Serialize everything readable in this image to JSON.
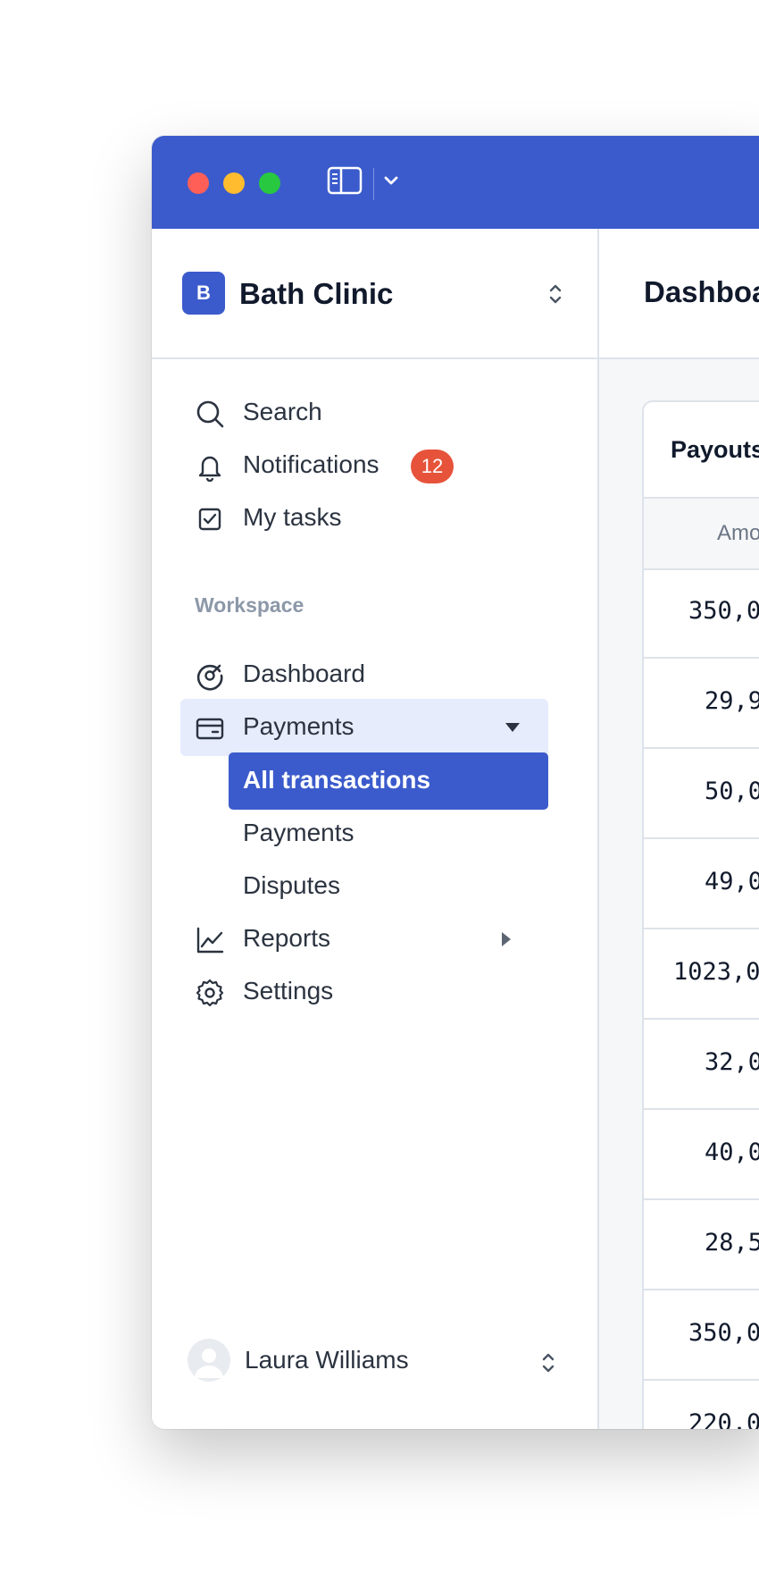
{
  "org": {
    "initial": "B",
    "name": "Bath Clinic"
  },
  "nav": {
    "search": "Search",
    "notifications": "Notifications",
    "notifications_count": "12",
    "tasks": "My tasks",
    "section": "Workspace",
    "dashboard": "Dashboard",
    "payments": "Payments",
    "payments_sub": [
      "All transactions",
      "Payments",
      "Disputes"
    ],
    "reports": "Reports",
    "settings": "Settings"
  },
  "user": {
    "name": "Laura Williams"
  },
  "main": {
    "title": "Dashboa",
    "card_title": "Payouts",
    "col_amount": "Amo",
    "amounts": [
      "350,0",
      "29,9",
      "50,0",
      "49,0",
      "1023,0",
      "32,0",
      "40,0",
      "28,5",
      "350,0",
      "220,0"
    ]
  },
  "colors": {
    "brand": "#3b5bcc",
    "badge": "#e6533a",
    "active_bg": "#e6ecfc"
  }
}
